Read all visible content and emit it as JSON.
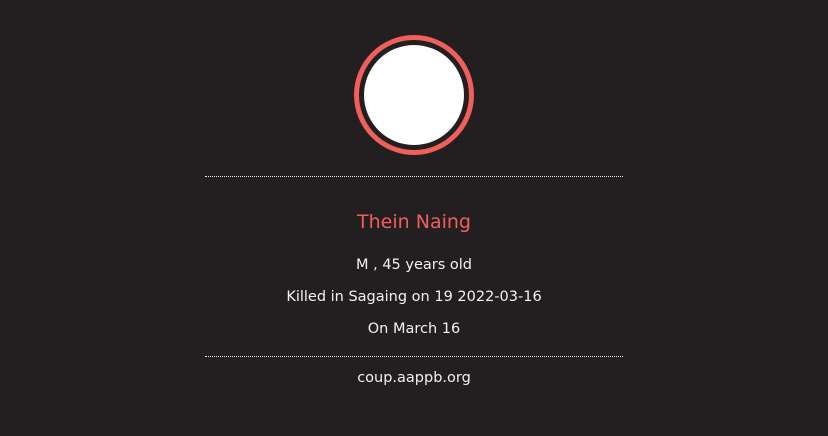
{
  "profile": {
    "name": "Thein Naing",
    "demographics": "M , 45 years old",
    "killed_text": "Killed in Sagaing on 19 2022-03-16",
    "date_text": "On March 16"
  },
  "footer": {
    "source": "coup.aappb.org"
  },
  "colors": {
    "background": "#231f20",
    "accent": "#ef5f5c",
    "text": "#f1f1f1",
    "photo_placeholder": "#ffffff"
  }
}
